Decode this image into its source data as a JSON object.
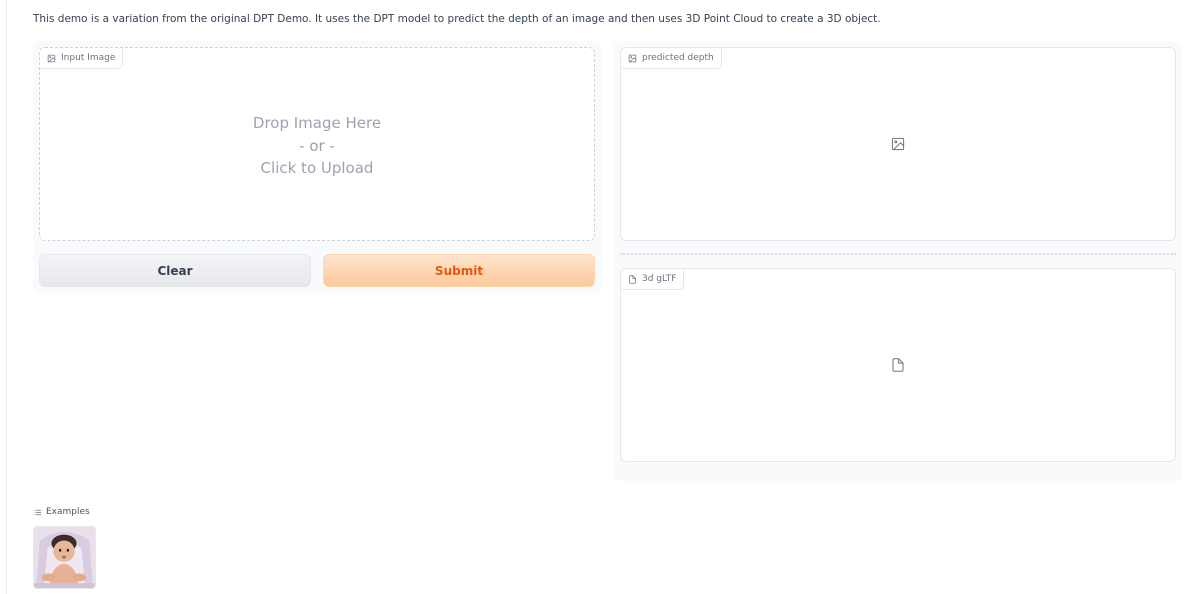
{
  "description": "This demo is a variation from the original DPT Demo. It uses the DPT model to predict the depth of an image and then uses 3D Point Cloud to create a 3D object.",
  "input": {
    "label": "Input Image",
    "drop_line1": "Drop Image Here",
    "drop_line2": "- or -",
    "drop_line3": "Click to Upload"
  },
  "buttons": {
    "clear": "Clear",
    "submit": "Submit"
  },
  "outputs": {
    "depth_label": "predicted depth",
    "gltf_label": "3d gLTF"
  },
  "examples": {
    "label": "Examples"
  },
  "icons": {
    "input_label_icon": "image-icon",
    "depth_label_icon": "image-icon",
    "depth_placeholder_icon": "image-icon",
    "gltf_label_icon": "file-icon",
    "gltf_placeholder_icon": "file-icon",
    "examples_icon": "list-icon"
  },
  "colors": {
    "submit_text": "#ea580c",
    "submit_bg": "#fdc89c",
    "clear_bg": "#f3f4f6"
  }
}
